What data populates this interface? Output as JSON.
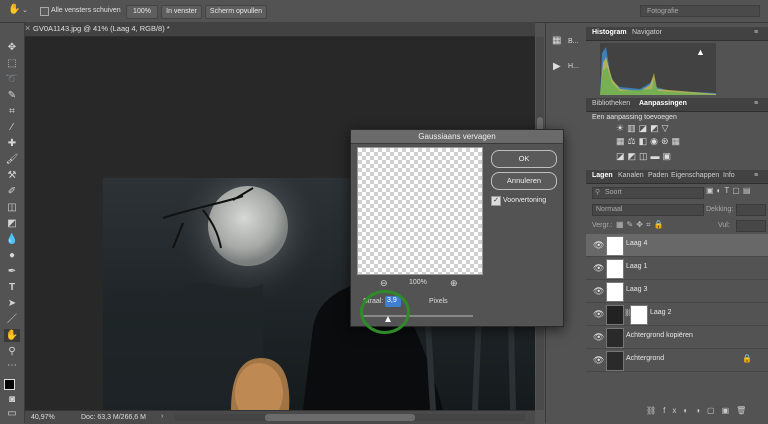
{
  "options_bar": {
    "all_windows_label": "Alle vensters schuiven",
    "zoom_100_label": "100%",
    "fit_window_label": "In venster",
    "fill_screen_label": "Scherm opvullen",
    "workspace_label": "Fotografie"
  },
  "document": {
    "tab_title": "GV0A1143.jpg @ 41% (Laag 4, RGB/8) *",
    "zoom_status": "40,97%",
    "doc_status": "Doc: 63,3 M/266,6 M"
  },
  "side_icons": {
    "item1": "B...",
    "item2": "H..."
  },
  "panels": {
    "histogram_tabs": [
      "Histogram",
      "Navigator"
    ],
    "adjust_tabs": [
      "Bibliotheken",
      "Aanpassingen"
    ],
    "adjust_hint": "Een aanpassing toevoegen",
    "layer_tabs": [
      "Lagen",
      "Kanalen",
      "Paden",
      "Eigenschappen",
      "Info"
    ],
    "kind_label": "Soort",
    "blend_mode": "Normaal",
    "opacity_label": "Dekking:",
    "lock_label": "Vergr.:",
    "fill_label": "Vul:"
  },
  "layers": [
    {
      "name": "Laag 4",
      "selected": true
    },
    {
      "name": "Laag 1",
      "selected": false
    },
    {
      "name": "Laag 3",
      "selected": false
    },
    {
      "name": "Laag 2",
      "selected": false
    },
    {
      "name": "Achtergrond kopiëren",
      "selected": false
    },
    {
      "name": "Achtergrond",
      "selected": false
    }
  ],
  "dialog": {
    "title": "Gaussiaans vervagen",
    "ok_label": "OK",
    "cancel_label": "Annuleren",
    "preview_label": "Voorvertoning",
    "preview_checked": true,
    "zoom_level": "100%",
    "radius_label": "Straal:",
    "radius_value": "3,9",
    "unit_label": "Pixels",
    "slider_fraction": 0.23
  },
  "colors": {
    "panel_bg": "#535353",
    "canvas_bg": "#282828",
    "highlight_circle": "#2f8a2a"
  }
}
